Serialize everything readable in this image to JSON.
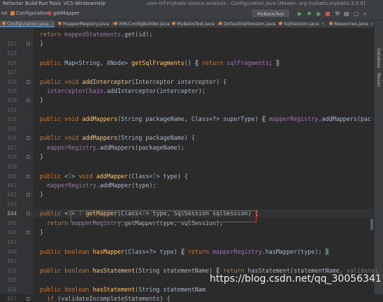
{
  "window": {
    "title": "com-tcf-mybatis-source-analysis - Configuration.java [Maven: org.mybatis:mybatis:3.5.6]"
  },
  "menu": [
    "Refactor",
    "Build",
    "Run",
    "Tools",
    "VCS",
    "Window",
    "Help"
  ],
  "breadcrumb": [
    {
      "label": "on",
      "color": "#7c7c7c"
    },
    {
      "label": "Configuration",
      "color": "#e07c3c"
    },
    {
      "label": "getMapper",
      "color": "#c2494c"
    }
  ],
  "run_config": {
    "label": "MyBatisTest"
  },
  "tabs": [
    {
      "label": "Configuration.java",
      "active": true
    },
    {
      "label": "MapperRegistry.java",
      "active": false
    },
    {
      "label": "XMLConfigBuilder.java",
      "active": false
    },
    {
      "label": "MyBatisTest.java",
      "active": false
    },
    {
      "label": "DefaultSqlSession.java",
      "active": false
    },
    {
      "label": "SqlSession.java",
      "active": false
    },
    {
      "label": "Resources.java",
      "active": false
    }
  ],
  "right_sidebar": [
    "Database",
    "Maven"
  ],
  "current_line": "844",
  "code_lines": [
    {
      "n": "",
      "t": [
        [
          "kw",
          "return "
        ],
        [
          "fld",
          "mappedStatements"
        ],
        [
          "",
          "."
        ],
        [
          "",
          "get(id);"
        ]
      ]
    },
    {
      "n": "822",
      "t": [
        [
          "",
          "}"
        ]
      ]
    },
    {
      "n": "823",
      "t": []
    },
    {
      "n": "824",
      "t": [
        [
          "kw",
          "public "
        ],
        [
          "",
          "Map<String, XNode> "
        ],
        [
          "fn",
          "getSqlFragments"
        ],
        [
          "",
          "() "
        ],
        [
          "brk",
          "{"
        ],
        [
          "",
          " "
        ],
        [
          "kw",
          "return "
        ],
        [
          "fld",
          "sqlFragments"
        ],
        [
          "",
          "; "
        ],
        [
          "brk",
          "}"
        ]
      ]
    },
    {
      "n": "827",
      "t": []
    },
    {
      "n": "828",
      "t": [
        [
          "kw",
          "public void "
        ],
        [
          "fn",
          "addInterceptor"
        ],
        [
          "",
          "(Interceptor interceptor) {"
        ]
      ]
    },
    {
      "n": "829",
      "t": [
        [
          "",
          "  "
        ],
        [
          "fld",
          "interceptorChain"
        ],
        [
          "",
          ".addInterceptor(interceptor);"
        ]
      ]
    },
    {
      "n": "830",
      "t": [
        [
          "",
          "}"
        ]
      ]
    },
    {
      "n": "831",
      "t": []
    },
    {
      "n": "832",
      "t": [
        [
          "kw",
          "public void "
        ],
        [
          "fn",
          "addMappers"
        ],
        [
          "",
          "(String packageName, Class<?> superType) "
        ],
        [
          "brk",
          "{"
        ],
        [
          "",
          " "
        ],
        [
          "fld",
          "mapperRegistry"
        ],
        [
          "",
          ".addMappers(pac"
        ]
      ]
    },
    {
      "n": "835",
      "t": []
    },
    {
      "n": "836",
      "t": [
        [
          "kw",
          "public void "
        ],
        [
          "fn",
          "addMappers"
        ],
        [
          "",
          "(String packageName) {"
        ]
      ]
    },
    {
      "n": "837",
      "t": [
        [
          "",
          "  "
        ],
        [
          "fld",
          "mapperRegistry"
        ],
        [
          "",
          ".addMappers(packageName);"
        ]
      ]
    },
    {
      "n": "838",
      "t": [
        [
          "",
          "}"
        ]
      ]
    },
    {
      "n": "839",
      "t": []
    },
    {
      "n": "840",
      "t": [
        [
          "kw",
          "public "
        ],
        [
          "",
          "<"
        ],
        [
          "tp",
          "T"
        ],
        [
          "",
          "> "
        ],
        [
          "kw",
          "void "
        ],
        [
          "fn",
          "addMapper"
        ],
        [
          "",
          "(Class<"
        ],
        [
          "tp",
          "T"
        ],
        [
          "",
          "> type) {"
        ]
      ]
    },
    {
      "n": "841",
      "t": [
        [
          "",
          "  "
        ],
        [
          "fld",
          "mapperRegistry"
        ],
        [
          "",
          ".addMapper(type);"
        ]
      ]
    },
    {
      "n": "842",
      "t": [
        [
          "",
          "}"
        ]
      ]
    },
    {
      "n": "843",
      "t": []
    },
    {
      "n": "844",
      "t": [
        [
          "kw",
          "public "
        ],
        [
          "",
          "<"
        ],
        [
          "tp",
          "T"
        ],
        [
          "",
          "> "
        ],
        [
          "tp",
          "T "
        ],
        [
          "fn",
          "getMapper"
        ],
        [
          "",
          "(Class<"
        ],
        [
          "tp",
          "T"
        ],
        [
          "",
          "> type, SqlSession sqlSession) {"
        ]
      ]
    },
    {
      "n": "845",
      "t": [
        [
          "",
          "  "
        ],
        [
          "kw",
          "return "
        ],
        [
          "fld",
          "mapperRegistry"
        ],
        [
          "",
          ".getMapper(type, sqlSession);"
        ]
      ]
    },
    {
      "n": "846",
      "t": [
        [
          "",
          "}"
        ]
      ]
    },
    {
      "n": "847",
      "t": []
    },
    {
      "n": "848",
      "t": [
        [
          "kw",
          "public boolean "
        ],
        [
          "fn",
          "hasMapper"
        ],
        [
          "",
          "(Class<?> type) "
        ],
        [
          "brk",
          "{"
        ],
        [
          "",
          " "
        ],
        [
          "kw",
          "return "
        ],
        [
          "fld",
          "mapperRegistry"
        ],
        [
          "",
          ".hasMapper(type); "
        ],
        [
          "brk",
          "}"
        ]
      ]
    },
    {
      "n": "851",
      "t": []
    },
    {
      "n": "852",
      "t": [
        [
          "kw",
          "public boolean "
        ],
        [
          "fn",
          "hasStatement"
        ],
        [
          "",
          "(String statementName) "
        ],
        [
          "brk",
          "{"
        ],
        [
          "",
          " "
        ],
        [
          "kw",
          "return "
        ],
        [
          "",
          "hasStatement(statementName, "
        ],
        [
          "hint",
          "validatel"
        ]
      ]
    },
    {
      "n": "855",
      "t": []
    },
    {
      "n": "856",
      "t": [
        [
          "kw",
          "public boolean "
        ],
        [
          "fn",
          "hasStatement"
        ],
        [
          "",
          "(String statementNam"
        ]
      ]
    },
    {
      "n": "857",
      "t": [
        [
          "",
          "  "
        ],
        [
          "kw",
          "if "
        ],
        [
          "",
          "(validateIncompleteStatements) {"
        ]
      ]
    }
  ],
  "watermark": "https://blog.csdn.net/qq_30056341"
}
